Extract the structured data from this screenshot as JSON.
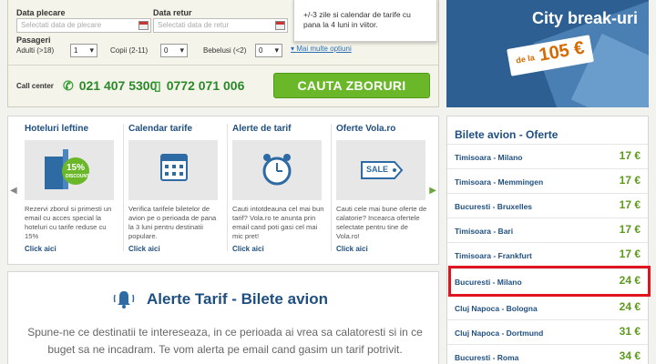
{
  "search": {
    "depart_label": "Data plecare",
    "depart_placeholder": "Selectati data de plecare",
    "return_label": "Data retur",
    "return_placeholder": "Selectati data de retur",
    "passengers_label": "Pasageri",
    "adults_label": "Adulti (>18)",
    "adults_value": "1",
    "children_label": "Copii (2-11)",
    "children_value": "0",
    "infants_label": "Bebelusi (<2)",
    "infants_value": "0",
    "more_options": "Mai multe optiuni",
    "note": "+/-3 zile si calendar de tarife cu pana la 4 luni in viitor.",
    "callcenter_label": "Call center",
    "phone1": "021 407 5300",
    "phone2": "0772 071 006",
    "cta_label": "CAUTA ZBORURI"
  },
  "banner": {
    "title": "City break-uri",
    "price_prefix": "de la",
    "price": "105 €"
  },
  "promos": [
    {
      "title": "Hoteluri leftine",
      "badge_value": "15%",
      "badge_text": "DISCOUNT",
      "text": "Rezervi zborul si primesti un email cu acces special la hoteluri cu tarife reduse cu 15%",
      "link": "Click aici"
    },
    {
      "title": "Calendar tarife",
      "text": "Verifica tarifele biletelor de avion pe o perioada de pana la 3 luni pentru destinatii populare.",
      "link": "Click aici"
    },
    {
      "title": "Alerte de tarif",
      "text": "Cauti intotdeauna cel mai bun tarif? Vola.ro te anunta prin email cand poti gasi cel mai mic pret!",
      "link": "Click aici"
    },
    {
      "title": "Oferte Vola.ro",
      "badge_text": "SALE",
      "text": "Cauti cele mai bune oferte de calatorie? Incearca ofertele selectate pentru tine de Vola.ro!",
      "link": "Click aici"
    }
  ],
  "alert": {
    "title": "Alerte Tarif - Bilete avion",
    "text": "Spune-ne ce destinatii te intereseaza, in ce perioada ai vrea sa calatoresti si in ce buget sa ne incadram. Te vom alerta pe email cand gasim un tarif potrivit."
  },
  "offers": {
    "title": "Bilete avion - Oferte",
    "rows": [
      {
        "route": "Timisoara - Milano",
        "price": "17 €"
      },
      {
        "route": "Timisoara - Memmingen",
        "price": "17 €"
      },
      {
        "route": "Bucuresti - Bruxelles",
        "price": "17 €"
      },
      {
        "route": "Timisoara - Bari",
        "price": "17 €"
      },
      {
        "route": "Timisoara - Frankfurt",
        "price": "17 €"
      },
      {
        "route": "Bucuresti - Milano",
        "price": "24 €"
      },
      {
        "route": "Cluj Napoca - Bologna",
        "price": "24 €"
      },
      {
        "route": "Cluj Napoca - Dortmund",
        "price": "31 €"
      },
      {
        "route": "Bucuresti - Roma",
        "price": "34 €"
      }
    ]
  },
  "colors": {
    "accent_green": "#6ab82a",
    "brand_blue": "#1f4f80",
    "highlight_red": "#e0141e"
  }
}
